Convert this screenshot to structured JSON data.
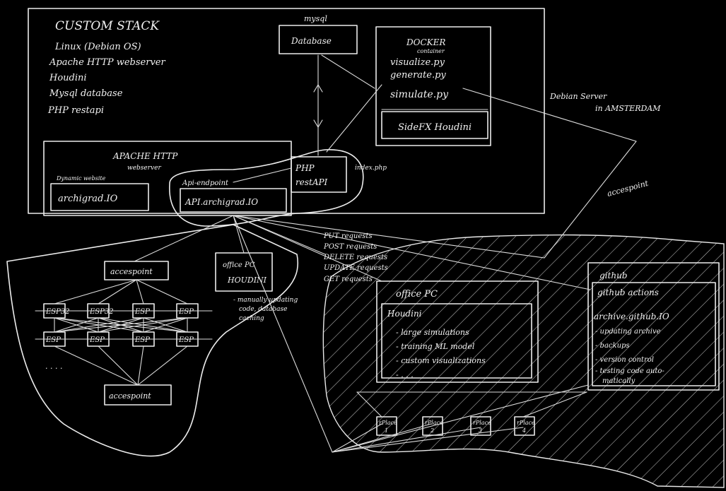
{
  "stack": {
    "title": "CUSTOM STACK",
    "items": [
      "Linux (Debian OS)",
      "Apache HTTP webserver",
      "Houdini",
      "Mysql database",
      "PHP restapi"
    ]
  },
  "mysql": {
    "label": "mysql",
    "database": "Database"
  },
  "docker": {
    "title": "DOCKER",
    "subtitle": "container",
    "files": [
      "visualize.py",
      "generate.py",
      "simulate.py"
    ],
    "sidefx": "SideFX Houdini"
  },
  "server": {
    "label_line1": "Debian Server",
    "label_line2": "in AMSTERDAM",
    "accesspoint": "accespoint"
  },
  "apache": {
    "title": "APACHE HTTP",
    "subtitle": "webserver",
    "website_label": "Dynamic website",
    "website": "archigrad.IO",
    "api_label": "Api-endpoint",
    "api": "API.archigrad.IO"
  },
  "php": {
    "line1": "PHP",
    "line2": "restAPI",
    "file": "index.php"
  },
  "requests": [
    "PUT requests",
    "POST requests",
    "DELETE requests",
    "UPDATE requests",
    "GET requests"
  ],
  "office_small": {
    "line1": "office PC",
    "line2": "HOUDINI",
    "notes": [
      "- manually updating",
      "code, database",
      "caching"
    ]
  },
  "esp_network": {
    "accesspoint_top": "accespoint",
    "accesspoint_bottom": "accespoint",
    "row1": [
      "ESP32",
      "ESP32",
      "ESP",
      "ESP"
    ],
    "row2": [
      "ESP",
      "ESP",
      "ESP",
      "ESP"
    ],
    "more": ". . . ."
  },
  "office_big": {
    "title": "office PC",
    "houdini": "Houdini",
    "tasks": [
      "- large simulations",
      "- training ML model",
      "- custom visualizations",
      "- . . ."
    ]
  },
  "github": {
    "title": "github",
    "actions": "github actions",
    "site": "archive.github.IO",
    "items": [
      "- updating archive",
      "- backups",
      "- version control",
      "- testing code auto-",
      "matically"
    ]
  },
  "nodes": [
    "rPlace 1",
    "rPlace 2",
    "rPlace 3",
    "rPlace 4"
  ],
  "colors": {
    "background": "#000000",
    "ink": "#ececec"
  }
}
